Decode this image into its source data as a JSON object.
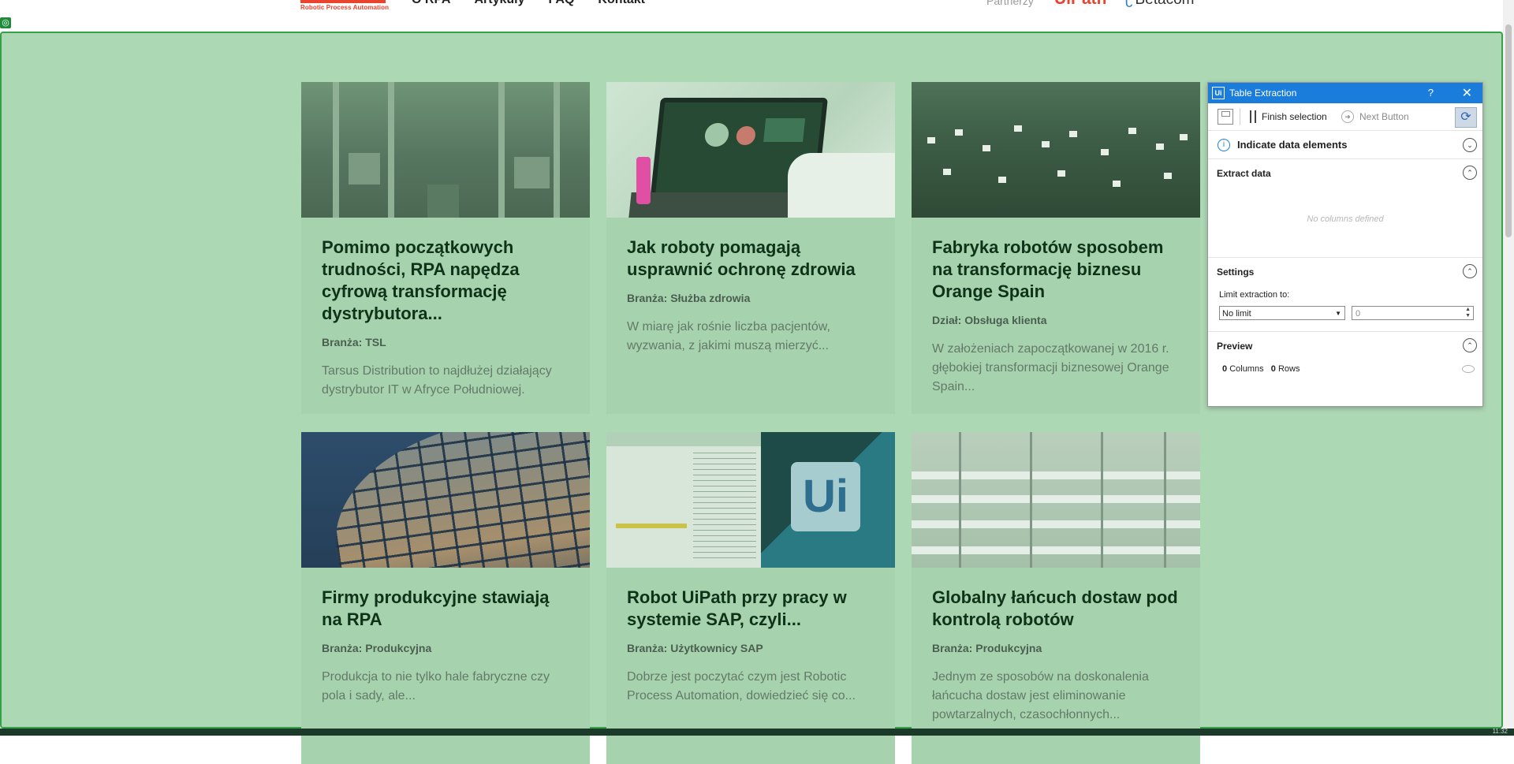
{
  "header": {
    "logo_sub": "Robotic Process Automation",
    "nav": [
      "O RPA",
      "Artykuły",
      "FAQ",
      "Kontakt"
    ],
    "partners_label": "Partnerzy",
    "uipath_logo": "UiPath",
    "betacom_logo": "Betacom"
  },
  "cards": [
    {
      "title": "Pomimo początkowych trudności, RPA napędza cyfrową transformację dystrybutora...",
      "meta": "Branża: TSL",
      "desc": "Tarsus Distribution to najdłużej działający dystrybutor IT w Afryce Południowej."
    },
    {
      "title": "Jak roboty pomagają usprawnić ochronę zdrowia",
      "meta": "Branża: Służba zdrowia",
      "desc": "W miarę jak rośnie liczba pacjentów, wyzwania, z jakimi muszą mierzyć..."
    },
    {
      "title": "Fabryka robotów sposobem na transformację biznesu Orange Spain",
      "meta": "Dział: Obsługa klienta",
      "desc": "W założeniach zapoczątkowanej w 2016 r. głębokiej transformacji biznesowej Orange Spain..."
    },
    {
      "title": "Firmy produkcyjne stawiają na RPA",
      "meta": "Branża: Produkcyjna",
      "desc": "Produkcja to nie tylko hale fabryczne czy pola i sady, ale..."
    },
    {
      "title": "Robot UiPath przy pracy w systemie SAP, czyli...",
      "meta": "Branża: Użytkownicy SAP",
      "desc": "Dobrze jest poczytać czym jest Robotic Process Automation, dowiedzieć się co..."
    },
    {
      "title": "Globalny łańcuch dostaw pod kontrolą robotów",
      "meta": "Branża: Produkcyjna",
      "desc": "Jednym ze sposobów na doskonalenia łańcucha dostaw jest eliminowanie powtarzalnych, czasochłonnych..."
    }
  ],
  "panel": {
    "title": "Table Extraction",
    "help": "?",
    "close": "✕",
    "finish_selection": "Finish selection",
    "next_button": "Next Button",
    "indicate": "Indicate data elements",
    "extract_data": "Extract data",
    "no_columns": "No columns defined",
    "settings": "Settings",
    "limit_label": "Limit extraction to:",
    "limit_value": "No limit",
    "limit_number": "0",
    "preview": "Preview",
    "columns_count": "0",
    "columns_label": "Columns",
    "rows_count": "0",
    "rows_label": "Rows"
  },
  "colors": {
    "overlay": "#add8b4",
    "overlay_border": "#34a048",
    "card_bg": "#a7d2ae",
    "panel_title": "#1b7ddb",
    "brand_red": "#e8442e"
  },
  "icons": [
    "green-selection-icon",
    "ui-logo-icon",
    "help-icon",
    "close-icon",
    "save-icon",
    "finish-icon",
    "next-icon",
    "refresh-icon",
    "info-icon",
    "chevron-down-icon",
    "chevron-up-icon",
    "eye-icon",
    "dropdown-arrow-icon",
    "spinner-icon"
  ],
  "taskbar": {
    "clock": "11:32"
  }
}
